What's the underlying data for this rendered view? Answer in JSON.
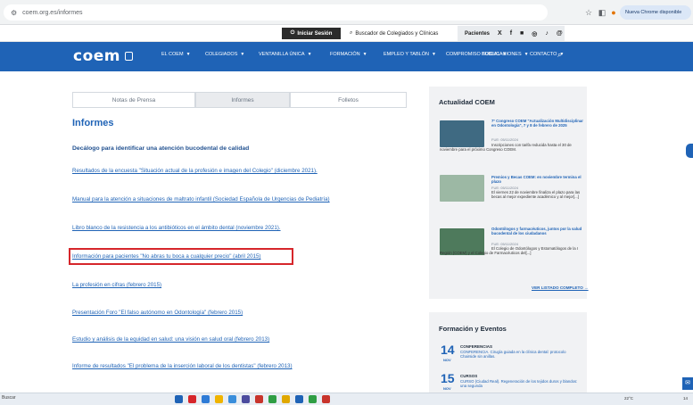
{
  "browser": {
    "url": "coem.org.es/informes",
    "chrome_button": "Nueva Chrome disponible"
  },
  "utility": {
    "login": "Iniciar Sesión",
    "search": "Buscador de Colegiados y Clínicas",
    "patients": "Pacientes",
    "social": [
      "X",
      "f"
    ]
  },
  "nav": {
    "logo": "coem",
    "items": [
      "EL COEM",
      "COLEGIADOS",
      "VENTANILLA ÚNICA",
      "FORMACIÓN",
      "EMPLEO Y TABLÓN",
      "COMPROMISO SOCIAL",
      "PUBLICACIONES",
      "CONTACTO"
    ]
  },
  "tabs": [
    "Notas de Prensa",
    "Informes",
    "Folletos"
  ],
  "main": {
    "title": "Informes",
    "links": [
      "Decálogo para identificar una atención bucodental de calidad",
      "Resultados de la encuesta \"Situación actual de la profesión e imagen del Colegio\" (diciembre 2021).",
      "Manual para la atención a situaciones de maltrato infantil (Sociedad Española de Urgencias de Pediatría)",
      "Libro blanco de la resistencia a los antibióticos en el ámbito dental (noviembre 2021).",
      "Información para pacientes \"No abras tu boca a cualquier precio\" (abril 2015)",
      "La profesión en cifras (febrero 2015)",
      "Presentación Foro \"El falso autónomo en Odontología\" (febrero 2015)",
      "Estudio y análisis de la equidad en salud: una visión en salud oral (febrero 2013)",
      "Informe de resultados \"El problema de la inserción laboral de los dentistas\" (febrero 2013)"
    ]
  },
  "sidebar": {
    "title": "Actualidad COEM",
    "news": [
      {
        "title": "7º Congreso COEM \"Actualización Multidisciplinar en Odontología\", 7 y 8 de febrero de 2025",
        "date": "FUE: 05/11/2024",
        "text": "Inscripciones con tarifa reducida hasta el 30 de noviembre para el próximo Congreso COEM."
      },
      {
        "title": "Premios y Becas COEM: en noviembre termina el plazo",
        "date": "FUE: 05/11/2024",
        "text": "El viernes 22 de noviembre finaliza el plazo para las becas al mejor expediente académico y al mejor[...]"
      },
      {
        "title": "Odontólogos y farmacéuticos, juntos por la salud bucodental de los ciudadanos",
        "date": "FUE: 05/11/2024",
        "text": "El Colegio de Odontólogos y Estomatólogos de la I Región (COEM) y el Colegio de Farmacéuticos del[...]"
      }
    ],
    "see_all": "VER LISTADO COMPLETO →"
  },
  "events": {
    "title": "Formación y Eventos",
    "items": [
      {
        "day": "14",
        "month": "NOV",
        "category": "CONFERENCIAS",
        "text": "CONFERENCIA. Cirugía guiada en la clínica dental: protocolo Chairside sin anillas."
      },
      {
        "day": "15",
        "month": "NOV",
        "category": "CURSOS",
        "text": "CURSO (Ciudad Real). Regeneración de los tejidos duros y blandos: una segunda"
      }
    ]
  },
  "taskbar": {
    "search": "Buscar",
    "weather": "22°C",
    "time": "14"
  }
}
